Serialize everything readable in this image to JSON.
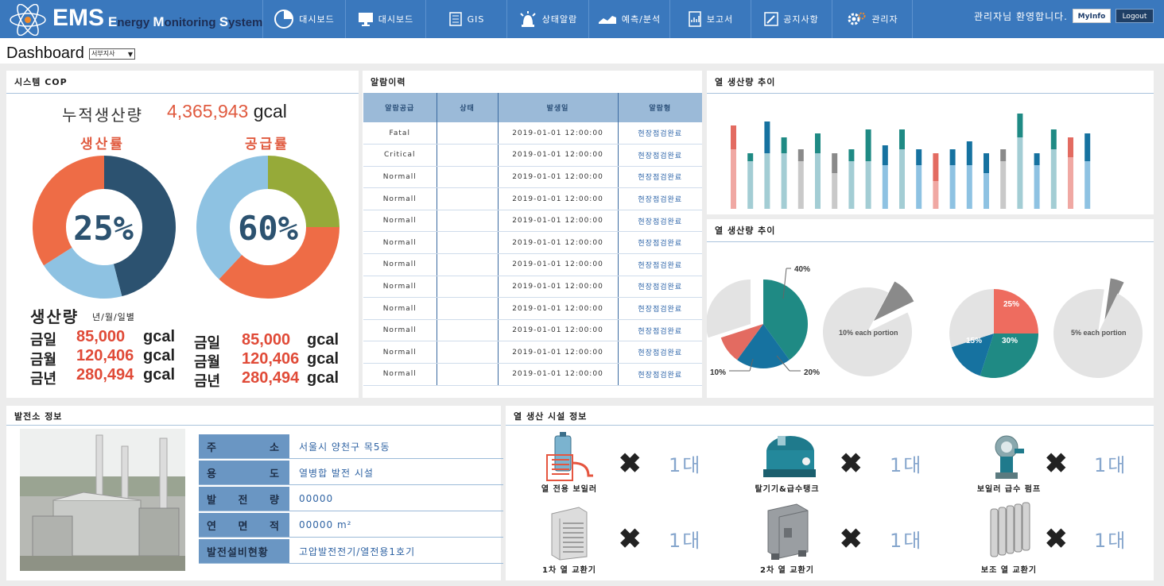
{
  "header": {
    "logo": "EMS",
    "logo_sub_1": "E",
    "logo_sub_2": "nergy ",
    "logo_sub_3": "M",
    "logo_sub_4": "onitoring ",
    "logo_sub_5": "S",
    "logo_sub_6": "ystem",
    "nav": [
      "대시보드",
      "대시보드",
      "GIS",
      "상태알람",
      "예측/분석",
      "보고서",
      "공지사항",
      "관리자"
    ],
    "nav_icons": [
      "pie-chart-icon",
      "monitor-icon",
      "map-icon",
      "alarm-icon",
      "trend-icon",
      "report-icon",
      "notice-icon",
      "gear-icon"
    ],
    "welcome": "관리자님 환영합니다.",
    "myinfo": "MyInfo",
    "logout": "Logout"
  },
  "page": {
    "title": "Dashboard",
    "site_select": "서부지사"
  },
  "cop": {
    "title": "시스템 COP",
    "cum_label": "누적생산량",
    "cum_value": "4,365,943",
    "cum_unit": "gcal",
    "prod_label": "생산률",
    "supply_label": "공급률",
    "prod_pct": "25%",
    "supply_pct": "60%",
    "prod_ratio": 0.25,
    "supply_ratio": 0.6,
    "amount_label": "생산량",
    "amount_sub": "년/월/일별",
    "rows_left": [
      {
        "label": "금일",
        "value": "85,000",
        "unit": "gcal"
      },
      {
        "label": "금월",
        "value": "120,406",
        "unit": "gcal"
      },
      {
        "label": "금년",
        "value": "280,494",
        "unit": "gcal"
      }
    ],
    "rows_right": [
      {
        "label": "금일",
        "value": "85,000",
        "unit": "gcal"
      },
      {
        "label": "금월",
        "value": "120,406",
        "unit": "gcal"
      },
      {
        "label": "금년",
        "value": "280,494",
        "unit": "gcal"
      }
    ],
    "colors": {
      "dark": "#2c5270",
      "light": "#8ec2e2",
      "orange": "#ee6c46",
      "olive": "#96aa39"
    }
  },
  "alarm": {
    "title": "알람이력",
    "headers": [
      "알람공급",
      "상태",
      "발생일",
      "알람형"
    ],
    "rows": [
      [
        "Fatal",
        "",
        "2019-01-01 12:00:00",
        "현장점검완료"
      ],
      [
        "Critical",
        "",
        "2019-01-01 12:00:00",
        "현장점검완료"
      ],
      [
        "Normall",
        "",
        "2019-01-01 12:00:00",
        "현장점검완료"
      ],
      [
        "Normall",
        "",
        "2019-01-01 12:00:00",
        "현장점검완료"
      ],
      [
        "Normall",
        "",
        "2019-01-01 12:00:00",
        "현장점검완료"
      ],
      [
        "Normall",
        "",
        "2019-01-01 12:00:00",
        "현장점검완료"
      ],
      [
        "Normall",
        "",
        "2019-01-01 12:00:00",
        "현장점검완료"
      ],
      [
        "Normall",
        "",
        "2019-01-01 12:00:00",
        "현장점검완료"
      ],
      [
        "Normall",
        "",
        "2019-01-01 12:00:00",
        "현장점검완료"
      ],
      [
        "Normall",
        "",
        "2019-01-01 12:00:00",
        "현장점검완료"
      ],
      [
        "Normall",
        "",
        "2019-01-01 12:00:00",
        "현장점검완료"
      ],
      [
        "Normall",
        "",
        "2019-01-01 12:00:00",
        "현장점검완료"
      ]
    ]
  },
  "heat_bar": {
    "title": "열 생산량 추이"
  },
  "heat_pie": {
    "title": "열 생산량 추이",
    "labels": [
      "40%",
      "20%",
      "10%",
      "10% each portion",
      "25%",
      "15%",
      "30%",
      "5% each portion"
    ]
  },
  "chart_data": [
    {
      "type": "bar",
      "stacked": true,
      "series": [
        {
          "values": [
            75,
            60,
            70,
            70,
            60,
            70,
            45,
            60,
            60,
            55,
            75,
            55,
            35,
            55,
            55,
            45,
            60,
            90,
            55,
            75,
            65,
            60
          ]
        },
        {
          "values": [
            30,
            10,
            40,
            20,
            15,
            25,
            25,
            15,
            40,
            25,
            25,
            20,
            35,
            20,
            30,
            25,
            15,
            30,
            15,
            25,
            25,
            35
          ]
        }
      ],
      "colors_bottom": [
        "#f0a8a3",
        "#a3cdd4",
        "#a3cdd4",
        "#a3cdd4",
        "#c9c9c9",
        "#a3cdd4",
        "#c9c9c9",
        "#a3cdd4",
        "#a3cdd4",
        "#8ec2e2",
        "#a3cdd4",
        "#8ec2e2",
        "#f0a8a3",
        "#8ec2e2",
        "#8ec2e2",
        "#8ec2e2",
        "#c9c9c9",
        "#a3cdd4",
        "#8ec2e2",
        "#a3cdd4",
        "#f0a8a3",
        "#8ec2e2"
      ],
      "colors_top": [
        "#e36b61",
        "#1f8a84",
        "#1672a0",
        "#1f8a84",
        "#8a8a8a",
        "#1f8a84",
        "#8a8a8a",
        "#1f8a84",
        "#1f8a84",
        "#1672a0",
        "#1f8a84",
        "#1672a0",
        "#e36b61",
        "#1672a0",
        "#1672a0",
        "#1672a0",
        "#8a8a8a",
        "#1f8a84",
        "#1672a0",
        "#1f8a84",
        "#e36b61",
        "#1672a0"
      ]
    },
    {
      "type": "pie",
      "slices": [
        {
          "label": "40%",
          "value": 40,
          "color": "#1f8a84"
        },
        {
          "label": "20%",
          "value": 20,
          "color": "#1672a0"
        },
        {
          "label": "10%",
          "value": 10,
          "color": "#e36b61"
        },
        {
          "label": "",
          "value": 30,
          "color": "#e3e3e3"
        }
      ]
    },
    {
      "type": "pie",
      "slices": [
        {
          "label": "10% each portion",
          "value": 10,
          "color": "#8a8a8a"
        },
        {
          "label": "",
          "value": 90,
          "color": "#e3e3e3"
        }
      ]
    },
    {
      "type": "pie",
      "slices": [
        {
          "label": "25%",
          "value": 25,
          "color": "#ee6c5f"
        },
        {
          "label": "30%",
          "value": 30,
          "color": "#1f8a84"
        },
        {
          "label": "15%",
          "value": 15,
          "color": "#1672a0"
        },
        {
          "label": "",
          "value": 30,
          "color": "#e3e3e3"
        }
      ]
    },
    {
      "type": "pie",
      "slices": [
        {
          "label": "5% each portion",
          "value": 5,
          "color": "#8a8a8a"
        },
        {
          "label": "",
          "value": 95,
          "color": "#e3e3e3"
        }
      ]
    }
  ],
  "plant": {
    "title": "발전소 정보",
    "rows": [
      {
        "key": "주 소",
        "value": "서울시 양천구 목5동"
      },
      {
        "key": "용 도",
        "value": "열병합 발전 시설"
      },
      {
        "key": "발 전 량",
        "value": "00000"
      },
      {
        "key": "연 면 적",
        "value": "00000 m²"
      },
      {
        "key": "발전설비현황",
        "value": "고압발전전기/열전용1호기"
      }
    ]
  },
  "facility": {
    "title": "열 생산 시설 정보",
    "items": [
      {
        "label": "열 전용 보일러",
        "count": "1대",
        "icon": "boiler-icon"
      },
      {
        "label": "탈기기&급수탱크",
        "count": "1대",
        "icon": "tank-icon"
      },
      {
        "label": "보일러 급수 펌프",
        "count": "1대",
        "icon": "pump-icon"
      },
      {
        "label": "1차 열 교환기",
        "count": "1대",
        "icon": "heat-exchanger-icon"
      },
      {
        "label": "2차 열 교환기",
        "count": "1대",
        "icon": "heat-exchanger-icon"
      },
      {
        "label": "보조 열 교환기",
        "count": "1대",
        "icon": "radiator-icon"
      }
    ]
  }
}
